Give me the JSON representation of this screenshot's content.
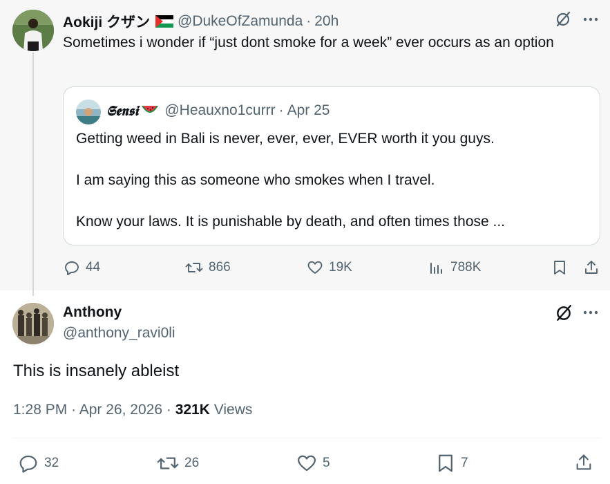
{
  "parent_tweet": {
    "display_name": "Aokiji クザン",
    "handle": "@DukeOfZamunda",
    "separator": "·",
    "time": "20h",
    "text": "Sometimes i wonder if “just dont smoke for a week” ever occurs as an option",
    "quote": {
      "display_name": "𝕾𝖊𝖓𝖘𝖎",
      "handle": "@Heauxno1currr",
      "separator": "·",
      "date": "Apr 25",
      "paragraphs": [
        "Getting weed in Bali is never, ever, ever, EVER worth it you guys.",
        "I am saying this as someone who smokes when I travel.",
        "Know your laws. It is punishable by death, and often times those ..."
      ]
    },
    "stats": {
      "replies": "44",
      "reposts": "866",
      "likes": "19K",
      "views": "788K"
    }
  },
  "main_tweet": {
    "display_name": "Anthony",
    "handle": "@anthony_ravi0li",
    "text": "This is insanely ableist",
    "time": "1:28 PM",
    "sep1": "·",
    "date": "Apr 26, 2026",
    "sep2": "·",
    "views_count": "321K",
    "views_label": "Views",
    "stats": {
      "replies": "32",
      "reposts": "26",
      "likes": "5",
      "bookmarks": "7"
    }
  },
  "icons": {
    "reply": "reply-icon",
    "repost": "repost-icon",
    "like": "heart-icon",
    "views": "views-icon",
    "bookmark": "bookmark-icon",
    "share": "share-icon",
    "grok": "grok-icon",
    "more": "more-icon"
  },
  "colors": {
    "text_primary": "#0f1419",
    "text_secondary": "#536471",
    "border": "#cfd9de",
    "parent_background": "#f7f7f7"
  }
}
